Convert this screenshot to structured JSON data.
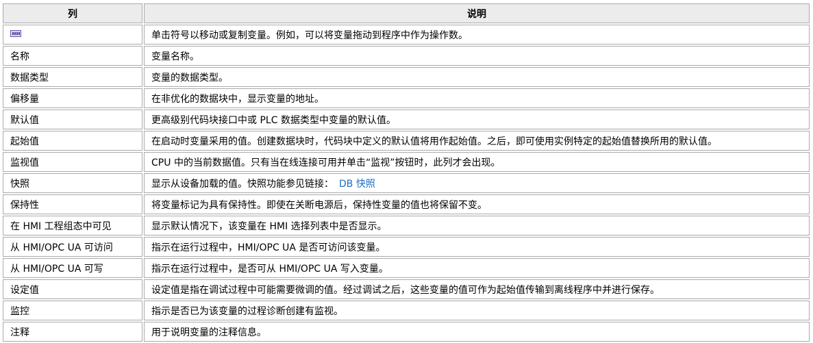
{
  "header": {
    "col1": "列",
    "col2": "说明"
  },
  "rows": [
    {
      "name": "",
      "desc": "单击符号以移动或复制变量。例如，可以将变量拖动到程序中作为操作数。"
    },
    {
      "name": "名称",
      "desc": "变量名称。"
    },
    {
      "name": "数据类型",
      "desc": "变量的数据类型。"
    },
    {
      "name": "偏移量",
      "desc": "在非优化的数据块中，显示变量的地址。"
    },
    {
      "name": "默认值",
      "desc": "更高级别代码块接口中或 PLC 数据类型中变量的默认值。"
    },
    {
      "name": "起始值",
      "desc": "在启动时变量采用的值。创建数据块时，代码块中定义的默认值将用作起始值。之后，即可使用实例特定的起始值替换所用的默认值。"
    },
    {
      "name": "监视值",
      "desc": "CPU 中的当前数据值。只有当在线连接可用并单击“监视”按钮时，此列才会出现。"
    },
    {
      "name": "快照",
      "desc": "显示从设备加载的值。快照功能参见链接：",
      "link": "DB 快照"
    },
    {
      "name": "保持性",
      "desc": "将变量标记为具有保持性。即使在关断电源后，保持性变量的值也将保留不变。"
    },
    {
      "name": "在 HMI 工程组态中可见",
      "desc": "显示默认情况下，该变量在 HMI 选择列表中是否显示。"
    },
    {
      "name": "从 HMI/OPC UA 可访问",
      "desc": "指示在运行过程中，HMI/OPC UA 是否可访问该变量。"
    },
    {
      "name": "从 HMI/OPC UA 可写",
      "desc": "指示在运行过程中，是否可从 HMI/OPC UA 写入变量。"
    },
    {
      "name": "设定值",
      "desc": "设定值是指在调试过程中可能需要微调的值。经过调试之后，这些变量的值可作为起始值传输到离线程序中并进行保存。"
    },
    {
      "name": "监控",
      "desc": "指示是否已为该变量的过程诊断创建有监视。"
    },
    {
      "name": "注释",
      "desc": "用于说明变量的注释信息。"
    }
  ],
  "icons": {
    "drag_symbol": "drag-variable-icon"
  }
}
